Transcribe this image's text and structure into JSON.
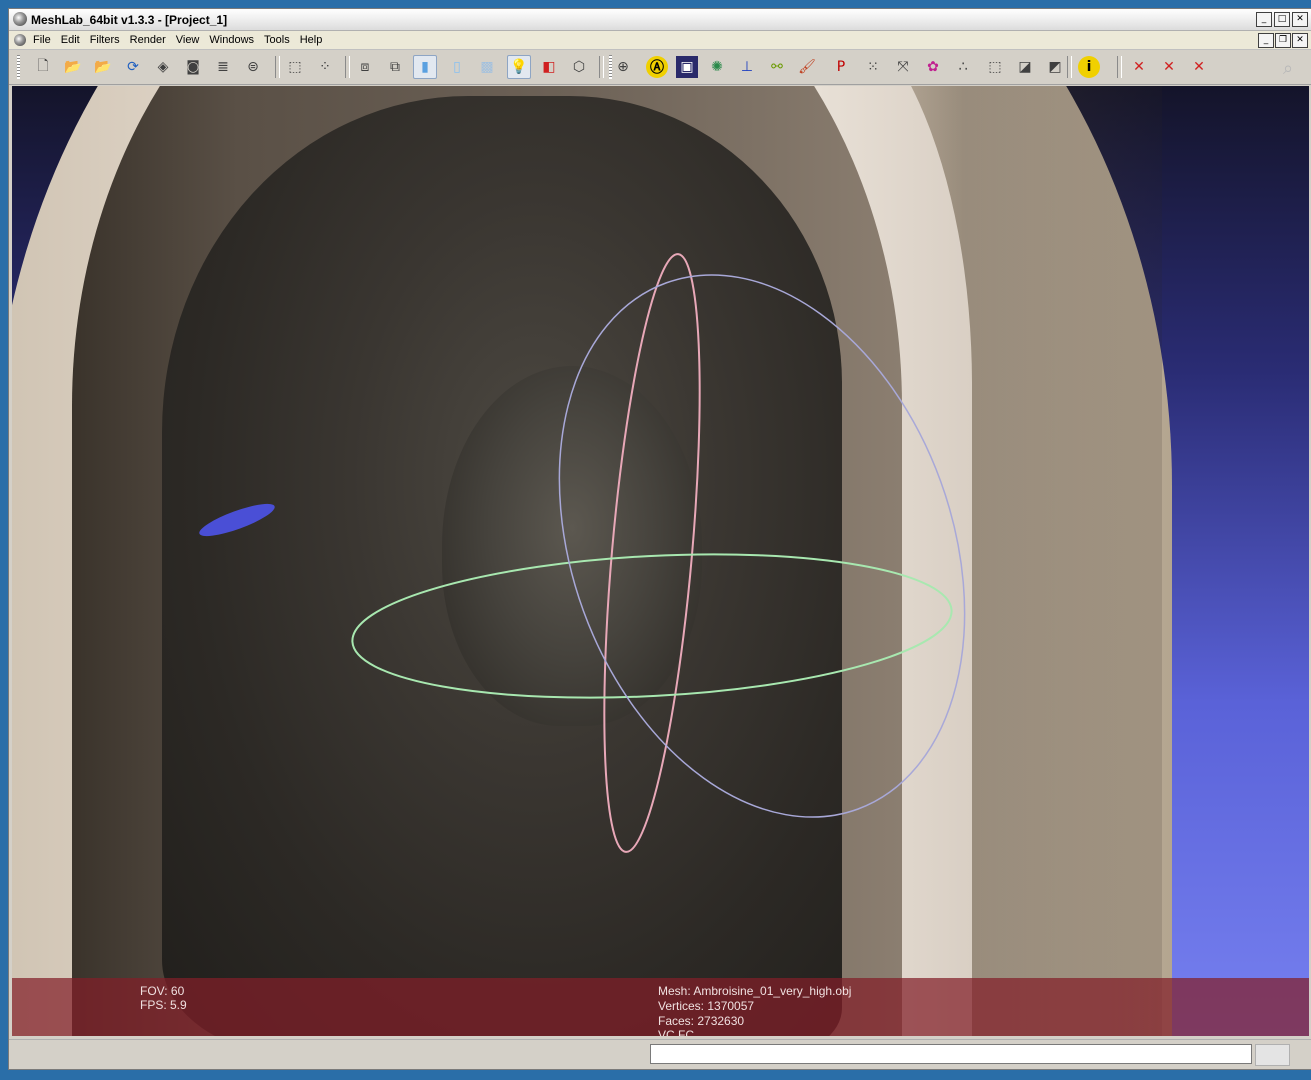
{
  "window": {
    "title": "MeshLab_64bit v1.3.3 - [Project_1]"
  },
  "window_controls": [
    "_",
    "□",
    "✕"
  ],
  "mdi_controls": [
    "_",
    "❐",
    "✕"
  ],
  "menu": [
    "File",
    "Edit",
    "Filters",
    "Render",
    "View",
    "Windows",
    "Tools",
    "Help"
  ],
  "toolbar": {
    "tools": [
      {
        "icon": "new-icon",
        "glyph": "🗋"
      },
      {
        "icon": "open-icon",
        "glyph": "📂"
      },
      {
        "icon": "open-project-icon",
        "glyph": "📂"
      },
      {
        "icon": "reload-icon",
        "glyph": "⟳"
      },
      {
        "icon": "save-icon",
        "glyph": "◈"
      },
      {
        "icon": "snapshot-icon",
        "glyph": "◙"
      },
      {
        "icon": "layers-icon",
        "glyph": "≣"
      },
      {
        "icon": "plugins-icon",
        "glyph": "⊜"
      },
      {
        "icon": "bbox-icon",
        "glyph": "⬚"
      },
      {
        "icon": "points-icon",
        "glyph": "⁘"
      },
      {
        "icon": "wireframe-icon",
        "glyph": "⧈"
      },
      {
        "icon": "hidden-lines-icon",
        "glyph": "⧉"
      },
      {
        "icon": "flat-shading-icon",
        "glyph": "▮"
      },
      {
        "icon": "smooth-shading-icon",
        "glyph": "▯"
      },
      {
        "icon": "texture-icon",
        "glyph": "▩"
      },
      {
        "icon": "light-icon",
        "glyph": "💡"
      },
      {
        "icon": "backface-icon",
        "glyph": "◧"
      },
      {
        "icon": "select-faces-icon",
        "glyph": "⬡"
      },
      {
        "icon": "trackball-icon",
        "glyph": "⊕"
      },
      {
        "icon": "annotation-icon",
        "glyph": "Ⓐ"
      },
      {
        "icon": "raster-icon",
        "glyph": "▣"
      },
      {
        "icon": "paint-icon",
        "glyph": "✺"
      },
      {
        "icon": "axes-icon",
        "glyph": "⊥"
      },
      {
        "icon": "measure-icon",
        "glyph": "⚯"
      },
      {
        "icon": "brush-icon",
        "glyph": "🖌"
      },
      {
        "icon": "pp-icon",
        "glyph": "P"
      },
      {
        "icon": "points-select-icon",
        "glyph": "⁙"
      },
      {
        "icon": "align-icon",
        "glyph": "⤧"
      },
      {
        "icon": "quality-icon",
        "glyph": "✿"
      },
      {
        "icon": "reference-icon",
        "glyph": "∴"
      },
      {
        "icon": "fragment-icon",
        "glyph": "⬚"
      },
      {
        "icon": "select-vertex-icon",
        "glyph": "◪"
      },
      {
        "icon": "select-face-icon",
        "glyph": "◩"
      },
      {
        "icon": "info-icon",
        "glyph": "i"
      },
      {
        "icon": "delete-vertices-icon",
        "glyph": "✕"
      },
      {
        "icon": "delete-faces-icon",
        "glyph": "✕"
      },
      {
        "icon": "delete-both-icon",
        "glyph": "✕"
      }
    ]
  },
  "info": {
    "fov": "FOV: 60",
    "fps": "FPS:     5.9",
    "mesh": "Mesh: Ambroisine_01_very_high.obj",
    "vertices": "Vertices: 1370057",
    "faces": "Faces: 2732630",
    "flags": "VC FC"
  },
  "status": {
    "progress": 0.0
  },
  "colors": {
    "info_bar": "#8a1e28",
    "background_top": "#14142a",
    "background_bottom": "#7680f0"
  }
}
